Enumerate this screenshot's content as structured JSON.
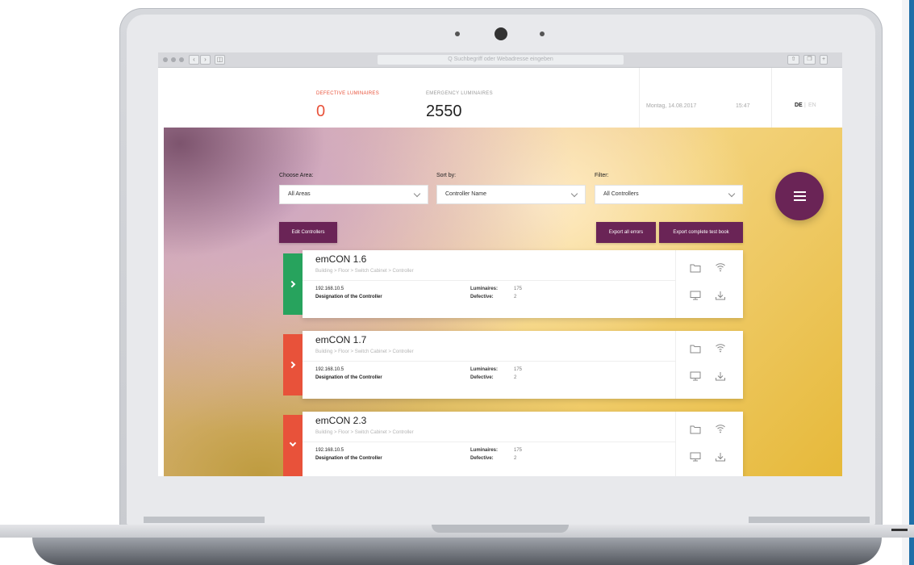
{
  "browser": {
    "address_placeholder": "Q  Suchbegriff oder Webadresse eingeben"
  },
  "header": {
    "defective_label": "DEFECTIVE LUMINAIRES",
    "defective_value": "0",
    "emergency_label": "EMERGENCY LUMINAIRES",
    "emergency_value": "2550",
    "date": "Montag, 14.08.2017",
    "time": "15:47",
    "lang_de": "DE",
    "lang_sep": "|",
    "lang_en": "EN"
  },
  "filters": {
    "area_label": "Choose Area:",
    "area_value": "All Areas",
    "sort_label": "Sort by:",
    "sort_value": "Controller Name",
    "filter_label": "Filter:",
    "filter_value": "All Controllers"
  },
  "actions": {
    "edit_controllers": "Edit Controllers",
    "export_errors": "Export all errors",
    "export_book": "Export complete test book"
  },
  "controllers": [
    {
      "name": "emCON 1.6",
      "path": "Building > Floor > Switch Cabinet > Controller",
      "ip": "192.168.10.5",
      "designation": "Designation of the Controller",
      "luminaires_label": "Luminaires:",
      "luminaires": "175",
      "defective_label": "Defective:",
      "defective": "2",
      "status": "ok",
      "expanded": false
    },
    {
      "name": "emCON 1.7",
      "path": "Building > Floor > Switch Cabinet > Controller",
      "ip": "192.168.10.5",
      "designation": "Designation of the Controller",
      "luminaires_label": "Luminaires:",
      "luminaires": "175",
      "defective_label": "Defective:",
      "defective": "2",
      "status": "error",
      "expanded": false
    },
    {
      "name": "emCON 2.3",
      "path": "Building > Floor > Switch Cabinet > Controller",
      "ip": "192.168.10.5",
      "designation": "Designation of the Controller",
      "luminaires_label": "Luminaires:",
      "luminaires": "175",
      "defective_label": "Defective:",
      "defective": "2",
      "status": "error",
      "expanded": true
    }
  ],
  "colors": {
    "accent": "#6a2456",
    "ok": "#27a35d",
    "error": "#e8523a",
    "defective_label": "#e8523a"
  },
  "icons": [
    "folder-icon",
    "wifi-icon",
    "monitor-icon",
    "download-icon",
    "menu-icon",
    "chevron-right-icon",
    "chevron-down-icon"
  ]
}
